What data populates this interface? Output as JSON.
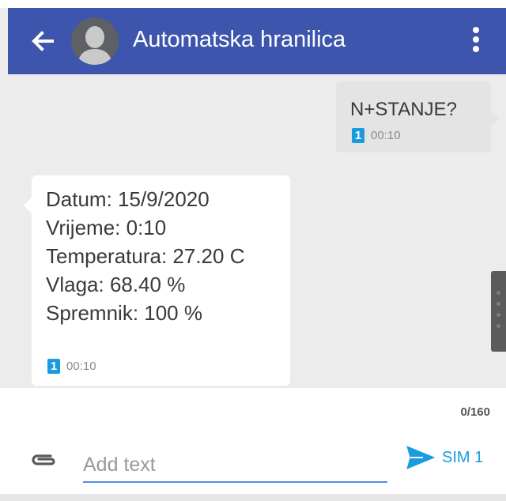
{
  "header": {
    "title": "Automatska hranilica",
    "back_icon": "arrow-left-icon",
    "avatar_icon": "person-avatar-icon",
    "menu_icon": "more-vert-icon",
    "color": "#3d55ad"
  },
  "messages": [
    {
      "direction": "outgoing",
      "lines": [
        "N+STANJE?"
      ],
      "sim": "1",
      "time": "00:10"
    },
    {
      "direction": "incoming",
      "lines": [
        "Datum: 15/9/2020",
        "Vrijeme: 0:10",
        "Temperatura: 27.20 C",
        "Vlaga: 68.40 %",
        "Spremnik: 100 %"
      ],
      "sim": "1",
      "time": "00:10"
    }
  ],
  "compose": {
    "counter": "0/160",
    "placeholder": "Add text",
    "value": "",
    "send_label": "SIM 1",
    "attach_icon": "paperclip-icon",
    "send_icon": "send-icon",
    "accent": "#1a9be0"
  }
}
